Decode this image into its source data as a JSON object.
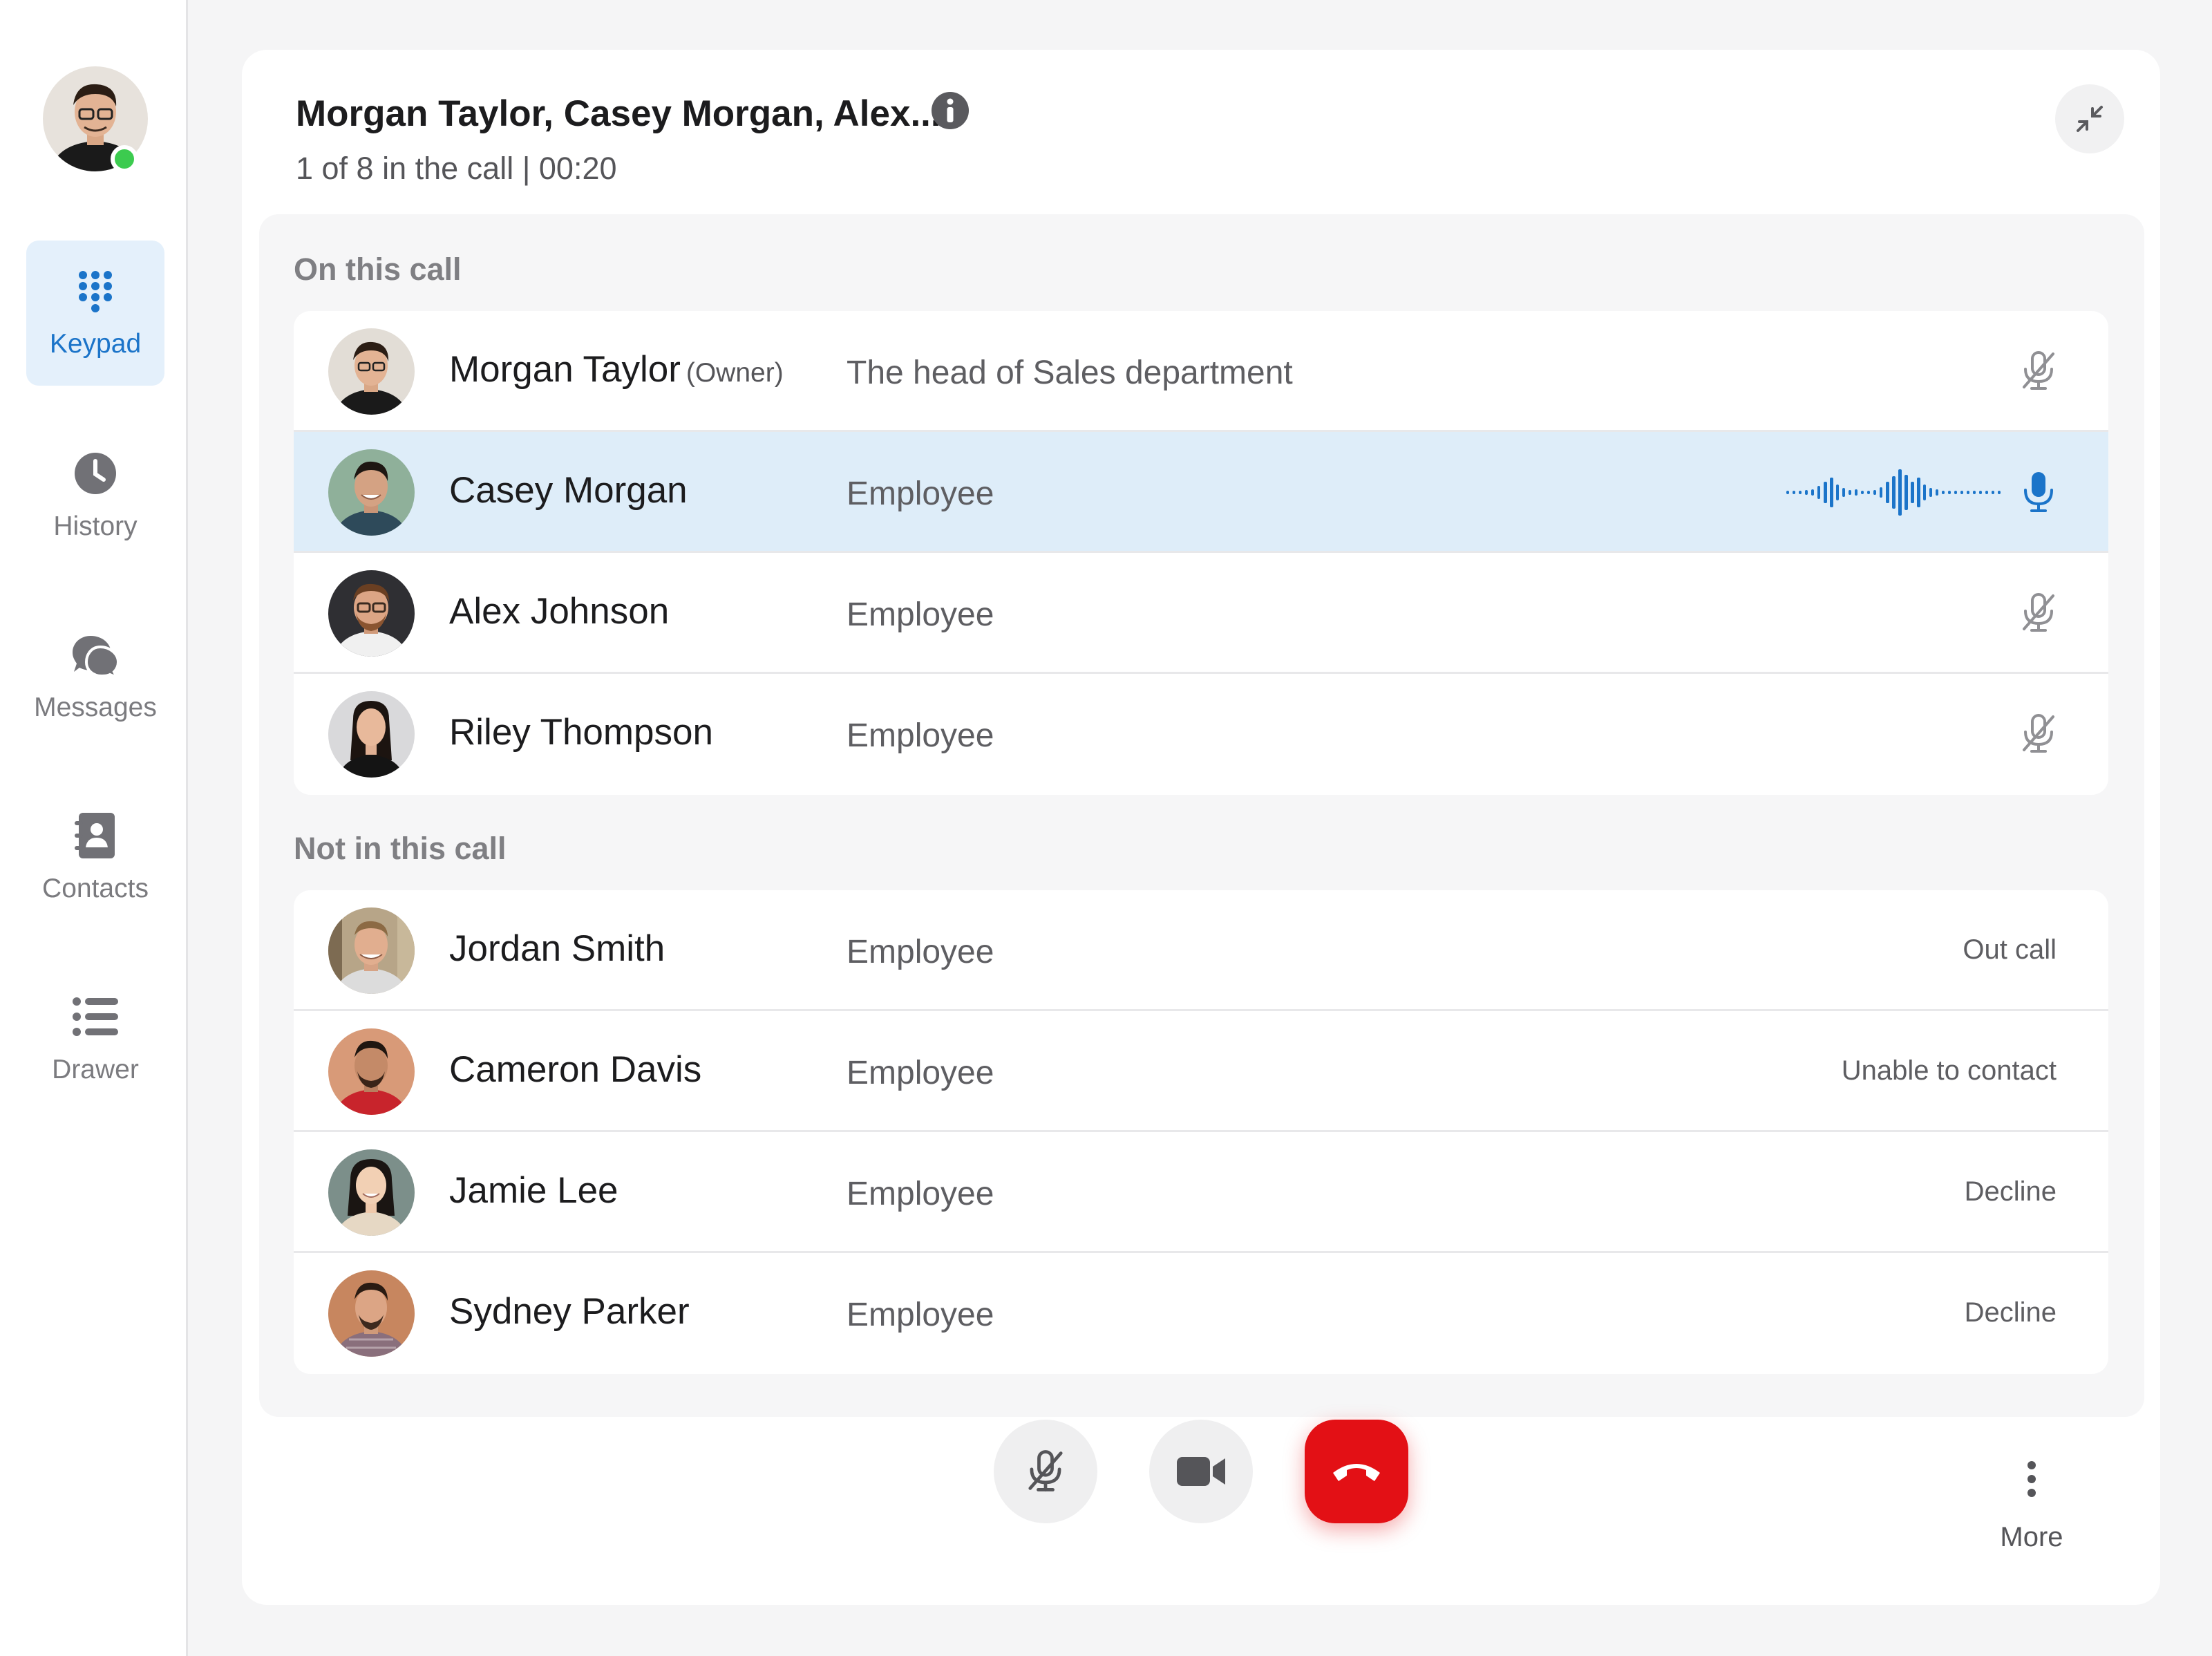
{
  "sidebar": {
    "items": [
      {
        "label": "Keypad",
        "icon": "keypad-icon",
        "active": true
      },
      {
        "label": "History",
        "icon": "clock-icon",
        "active": false
      },
      {
        "label": "Messages",
        "icon": "chat-icon",
        "active": false
      },
      {
        "label": "Contacts",
        "icon": "contacts-book-icon",
        "active": false
      },
      {
        "label": "Drawer",
        "icon": "list-icon",
        "active": false
      }
    ]
  },
  "call": {
    "title": "Morgan Taylor, Casey Morgan, Alex...",
    "subtitle": "1 of 8 in the call | 00:20"
  },
  "on_call": {
    "label": "On this call",
    "participants": [
      {
        "name": "Morgan Taylor",
        "tag": "(Owner)",
        "role": "The head of Sales department",
        "mic": "muted"
      },
      {
        "name": "Casey Morgan",
        "role": "Employee",
        "mic": "speaking"
      },
      {
        "name": "Alex Johnson",
        "role": "Employee",
        "mic": "muted"
      },
      {
        "name": "Riley Thompson",
        "role": "Employee",
        "mic": "muted"
      }
    ]
  },
  "not_in_call": {
    "label": "Not in this call",
    "participants": [
      {
        "name": "Jordan Smith",
        "role": "Employee",
        "status": "Out call"
      },
      {
        "name": "Cameron Davis",
        "role": "Employee",
        "status": "Unable to contact"
      },
      {
        "name": "Jamie Lee",
        "role": "Employee",
        "status": "Decline"
      },
      {
        "name": "Sydney Parker",
        "role": "Employee",
        "status": "Decline"
      }
    ]
  },
  "controls": {
    "more_label": "More"
  },
  "colors": {
    "accent": "#1b74c9",
    "active_bg": "#e4f0fb",
    "speaking_bg": "#deedf9",
    "online": "#3ccb4f",
    "end_call": "#e31015"
  }
}
